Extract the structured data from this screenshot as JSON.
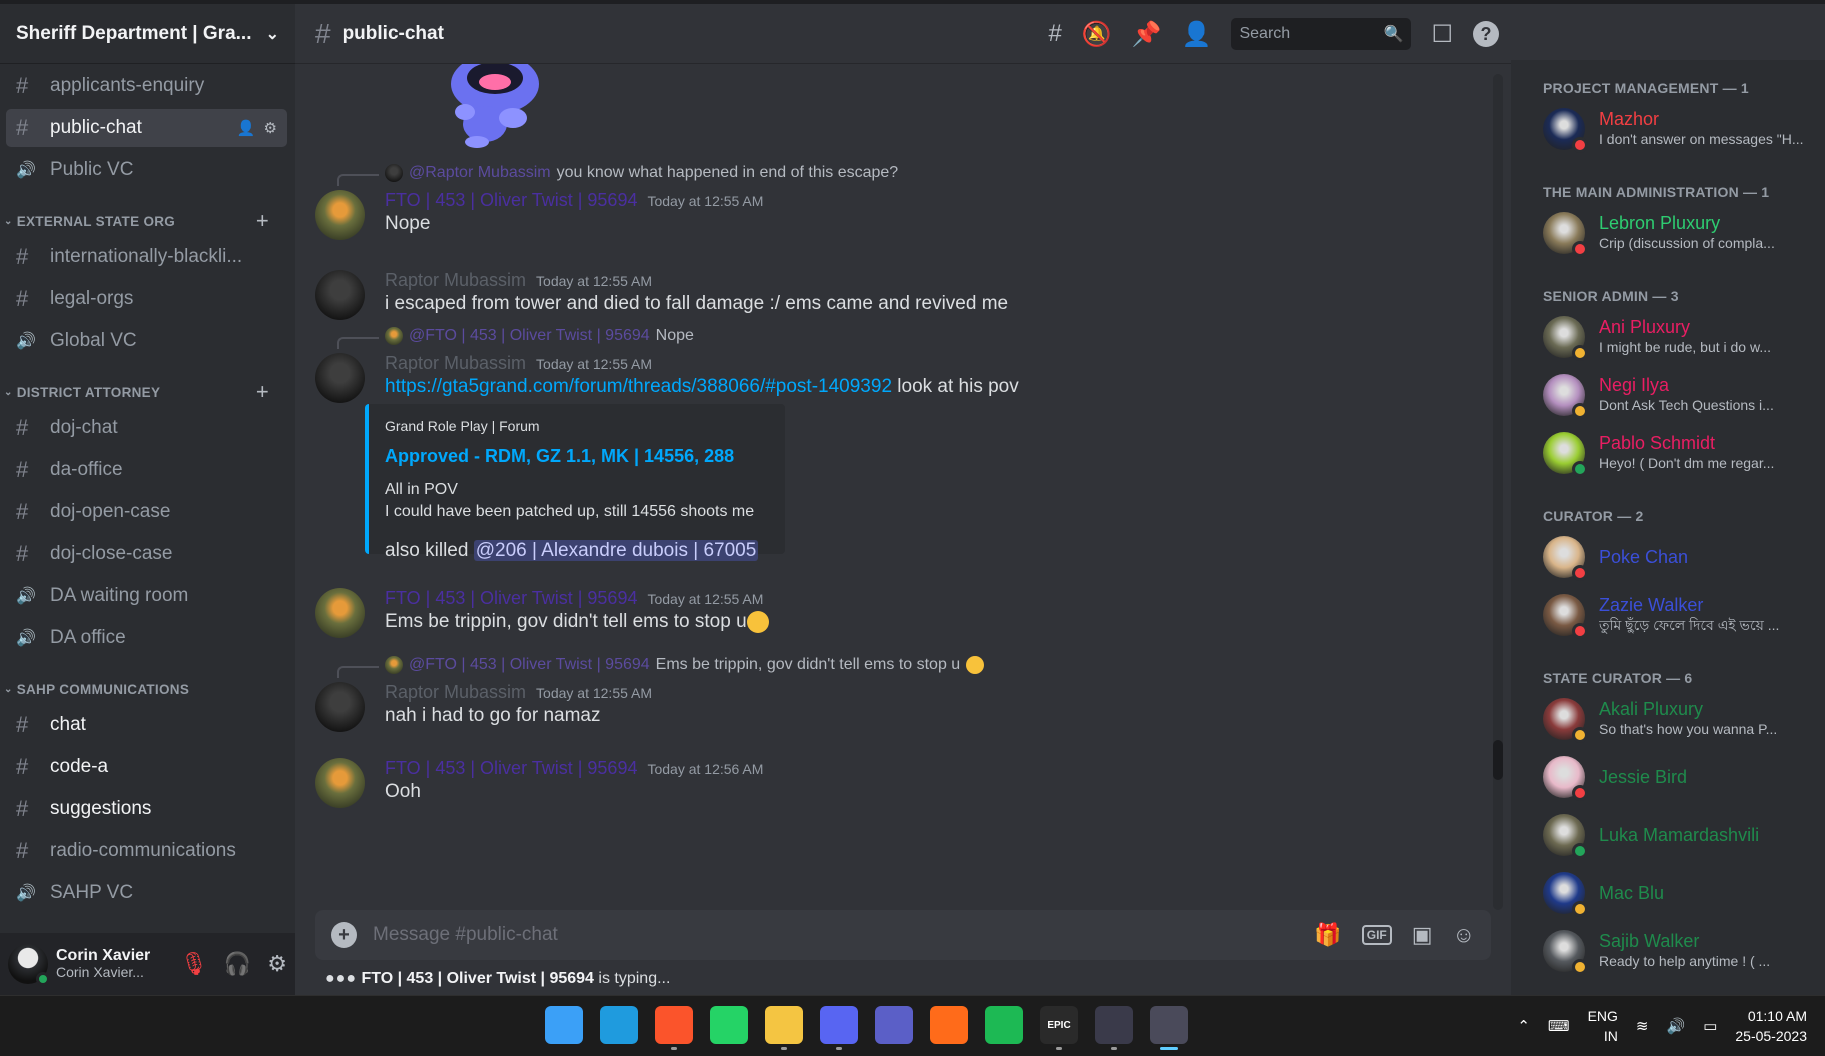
{
  "server": {
    "name": "Sheriff Department | Gra..."
  },
  "channel": {
    "name": "public-chat"
  },
  "sidebar": {
    "top_channels": [
      {
        "name": "applicants-enquiry",
        "type": "text"
      },
      {
        "name": "public-chat",
        "type": "text",
        "active": true
      },
      {
        "name": "Public VC",
        "type": "voice"
      }
    ],
    "categories": [
      {
        "name": "EXTERNAL STATE ORG",
        "channels": [
          {
            "name": "internationally-blackli...",
            "type": "text"
          },
          {
            "name": "legal-orgs",
            "type": "text"
          },
          {
            "name": "Global VC",
            "type": "voice"
          }
        ]
      },
      {
        "name": "DISTRICT ATTORNEY",
        "channels": [
          {
            "name": "doj-chat",
            "type": "text"
          },
          {
            "name": "da-office",
            "type": "text"
          },
          {
            "name": "doj-open-case",
            "type": "text"
          },
          {
            "name": "doj-close-case",
            "type": "text"
          },
          {
            "name": "DA waiting room",
            "type": "voice"
          },
          {
            "name": "DA office",
            "type": "voice"
          }
        ]
      },
      {
        "name": "SAHP COMMUNICATIONS",
        "channels": [
          {
            "name": "chat",
            "type": "text",
            "bright": true
          },
          {
            "name": "code-a",
            "type": "text",
            "bright": true
          },
          {
            "name": "suggestions",
            "type": "text",
            "bright": true
          },
          {
            "name": "radio-communications",
            "type": "text"
          },
          {
            "name": "SAHP VC",
            "type": "voice"
          }
        ]
      }
    ]
  },
  "user": {
    "name": "Corin Xavier",
    "sub": "Corin Xavier..."
  },
  "header": {
    "search_placeholder": "Search"
  },
  "messages": {
    "m1": {
      "reply_name": "@Raptor Mubassim",
      "reply_text": "you know what happened in end of this escape?",
      "author": "FTO | 453 | Oliver Twist | 95694",
      "time": "Today at 12:55 AM",
      "text": "Nope"
    },
    "m2": {
      "author": "Raptor Mubassim",
      "time": "Today at 12:55 AM",
      "text": "i escaped from tower and died to fall damage :/ ems came and revived me"
    },
    "m3": {
      "reply_name": "@FTO | 453 | Oliver Twist | 95694",
      "reply_text": "Nope",
      "author": "Raptor Mubassim",
      "time": "Today at 12:55 AM",
      "link": "https://gta5grand.com/forum/threads/388066/#post-1409392",
      "after_link": " look at his pov"
    },
    "embed": {
      "provider": "Grand Role Play | Forum",
      "title": "Approved - RDM, GZ 1.1, MK | 14556, 288",
      "line1": "All in POV",
      "line2": "I could have been patched up, still 14556 shoots me"
    },
    "m3b": {
      "prefix": "also killed ",
      "mention": "@206 | Alexandre dubois | 67005"
    },
    "m4": {
      "author": "FTO | 453 | Oliver Twist | 95694",
      "time": "Today at 12:55 AM",
      "text": "Ems be trippin, gov didn't tell ems to stop u"
    },
    "m5": {
      "reply_name": "@FTO | 453 | Oliver Twist | 95694",
      "reply_text": "Ems be trippin, gov didn't tell ems to stop u",
      "author": "Raptor Mubassim",
      "time": "Today at 12:55 AM",
      "text": "nah i had to go for namaz"
    },
    "m6": {
      "author": "FTO | 453 | Oliver Twist | 95694",
      "time": "Today at 12:56 AM",
      "text": "Ooh"
    }
  },
  "composer": {
    "placeholder": "Message #public-chat",
    "gif_label": "GIF"
  },
  "typing": {
    "who": "FTO | 453 | Oliver Twist | 95694",
    "suffix": " is typing..."
  },
  "members": [
    {
      "category": "PROJECT MANAGEMENT — 1",
      "items": [
        {
          "name": "Mazhor",
          "status": "I don't answer on messages \"H...",
          "color": "#f23f43",
          "presence": "dnd",
          "av": "#1b2b57"
        }
      ]
    },
    {
      "category": "THE MAIN ADMINISTRATION — 1",
      "items": [
        {
          "name": "Lebron Pluxury",
          "status": "Crip (discussion of compla...",
          "color": "#2ecc71",
          "presence": "dnd",
          "av": "#8a7b5a"
        }
      ]
    },
    {
      "category": "SENIOR ADMIN — 3",
      "items": [
        {
          "name": "Ani Pluxury",
          "status": "I might be rude, but i do w...",
          "color": "#e91e63",
          "presence": "idle",
          "av": "#6b6b55"
        },
        {
          "name": "Negi Ilya",
          "status": "Dont Ask Tech Questions i...",
          "color": "#e91e63",
          "presence": "idle",
          "av": "#b48fbf"
        },
        {
          "name": "Pablo Schmidt",
          "status": "Heyo! ( Don't dm me regar...",
          "color": "#e91e63",
          "presence": "on",
          "av": "#9acd32"
        }
      ]
    },
    {
      "category": "CURATOR — 2",
      "items": [
        {
          "name": "Poke Chan",
          "status": "",
          "color": "#3b4fd8",
          "presence": "dnd",
          "av": "#d9b58a"
        },
        {
          "name": "Zazie Walker",
          "status": "তুমি ছুঁড়ে ফেলে দিবে এই ভয়ে ...",
          "color": "#3b4fd8",
          "presence": "dnd",
          "av": "#7a5a44"
        }
      ]
    },
    {
      "category": "STATE CURATOR — 6",
      "items": [
        {
          "name": "Akali Pluxury",
          "status": "So that's how you wanna P...",
          "color": "#1f8b4c",
          "presence": "idle",
          "av": "#8a3b3b"
        },
        {
          "name": "Jessie Bird",
          "status": "",
          "color": "#1f8b4c",
          "presence": "dnd",
          "av": "#e8b9c9"
        },
        {
          "name": "Luka Mamardashvili",
          "status": "",
          "color": "#1f8b4c",
          "presence": "on",
          "av": "#6d6a52"
        },
        {
          "name": "Mac Blu",
          "status": "",
          "color": "#1f8b4c",
          "presence": "idle",
          "av": "#1f3a8a"
        },
        {
          "name": "Sajib Walker",
          "status": "Ready to help anytime ! ( ...",
          "color": "#1f8b4c",
          "presence": "idle",
          "av": "#55595e"
        }
      ]
    }
  ],
  "taskbar": {
    "lang1": "ENG",
    "lang2": "IN",
    "time": "01:10 AM",
    "date": "25-05-2023",
    "apps": [
      {
        "name": "start-icon",
        "label": "",
        "color": "#3ba0f7"
      },
      {
        "name": "edge-icon",
        "label": "",
        "color": "#1f9bde"
      },
      {
        "name": "brave-icon",
        "label": "",
        "color": "#fb542b",
        "run": true
      },
      {
        "name": "whatsapp-icon",
        "label": "",
        "color": "#25d366"
      },
      {
        "name": "file-explorer-icon",
        "label": "",
        "color": "#f4c542",
        "run": true
      },
      {
        "name": "discord-icon",
        "label": "",
        "color": "#5865f2",
        "run": true
      },
      {
        "name": "teams-icon",
        "label": "",
        "color": "#5b5fc7"
      },
      {
        "name": "app-icon",
        "label": "",
        "color": "#ff6b1a"
      },
      {
        "name": "spotify-icon",
        "label": "",
        "color": "#1db954"
      },
      {
        "name": "epic-games-icon",
        "label": "EPIC",
        "color": "#2a2a2a",
        "run": true
      },
      {
        "name": "launcher-icon",
        "label": "",
        "color": "#3a3a4a",
        "run": true
      },
      {
        "name": "snipping-tool-icon",
        "label": "",
        "color": "#4a4a5a",
        "active": true
      }
    ]
  }
}
